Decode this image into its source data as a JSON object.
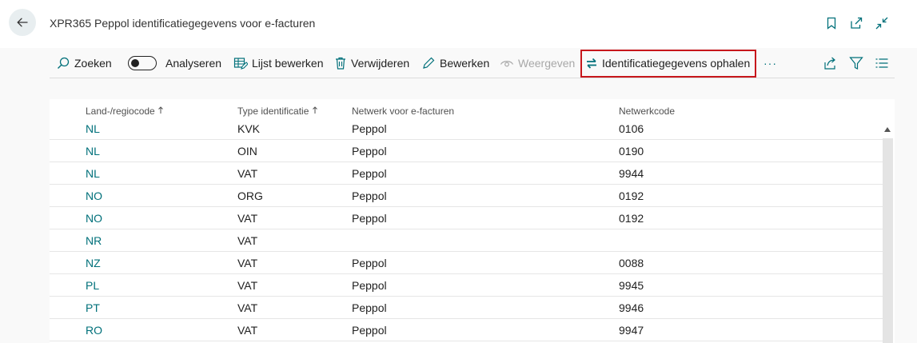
{
  "header": {
    "title": "XPR365 Peppol identificatiegegevens voor e-facturen"
  },
  "actions": {
    "search": "Zoeken",
    "analyze": "Analyseren",
    "edit_list": "Lijst bewerken",
    "delete": "Verwijderen",
    "edit": "Bewerken",
    "view": "Weergeven",
    "fetch": "Identificatiegegevens ophalen",
    "more": "···"
  },
  "columns": {
    "country": "Land-/regiocode",
    "type": "Type identificatie",
    "network": "Netwerk voor e-facturen",
    "code": "Netwerkcode"
  },
  "rows": [
    {
      "country": "NL",
      "type": "KVK",
      "network": "Peppol",
      "code": "0106"
    },
    {
      "country": "NL",
      "type": "OIN",
      "network": "Peppol",
      "code": "0190"
    },
    {
      "country": "NL",
      "type": "VAT",
      "network": "Peppol",
      "code": "9944"
    },
    {
      "country": "NO",
      "type": "ORG",
      "network": "Peppol",
      "code": "0192"
    },
    {
      "country": "NO",
      "type": "VAT",
      "network": "Peppol",
      "code": "0192"
    },
    {
      "country": "NR",
      "type": "VAT",
      "network": "",
      "code": ""
    },
    {
      "country": "NZ",
      "type": "VAT",
      "network": "Peppol",
      "code": "0088"
    },
    {
      "country": "PL",
      "type": "VAT",
      "network": "Peppol",
      "code": "9945"
    },
    {
      "country": "PT",
      "type": "VAT",
      "network": "Peppol",
      "code": "9946"
    },
    {
      "country": "RO",
      "type": "VAT",
      "network": "Peppol",
      "code": "9947"
    }
  ],
  "colors": {
    "accent": "#00707a",
    "highlight": "#c7171c"
  }
}
